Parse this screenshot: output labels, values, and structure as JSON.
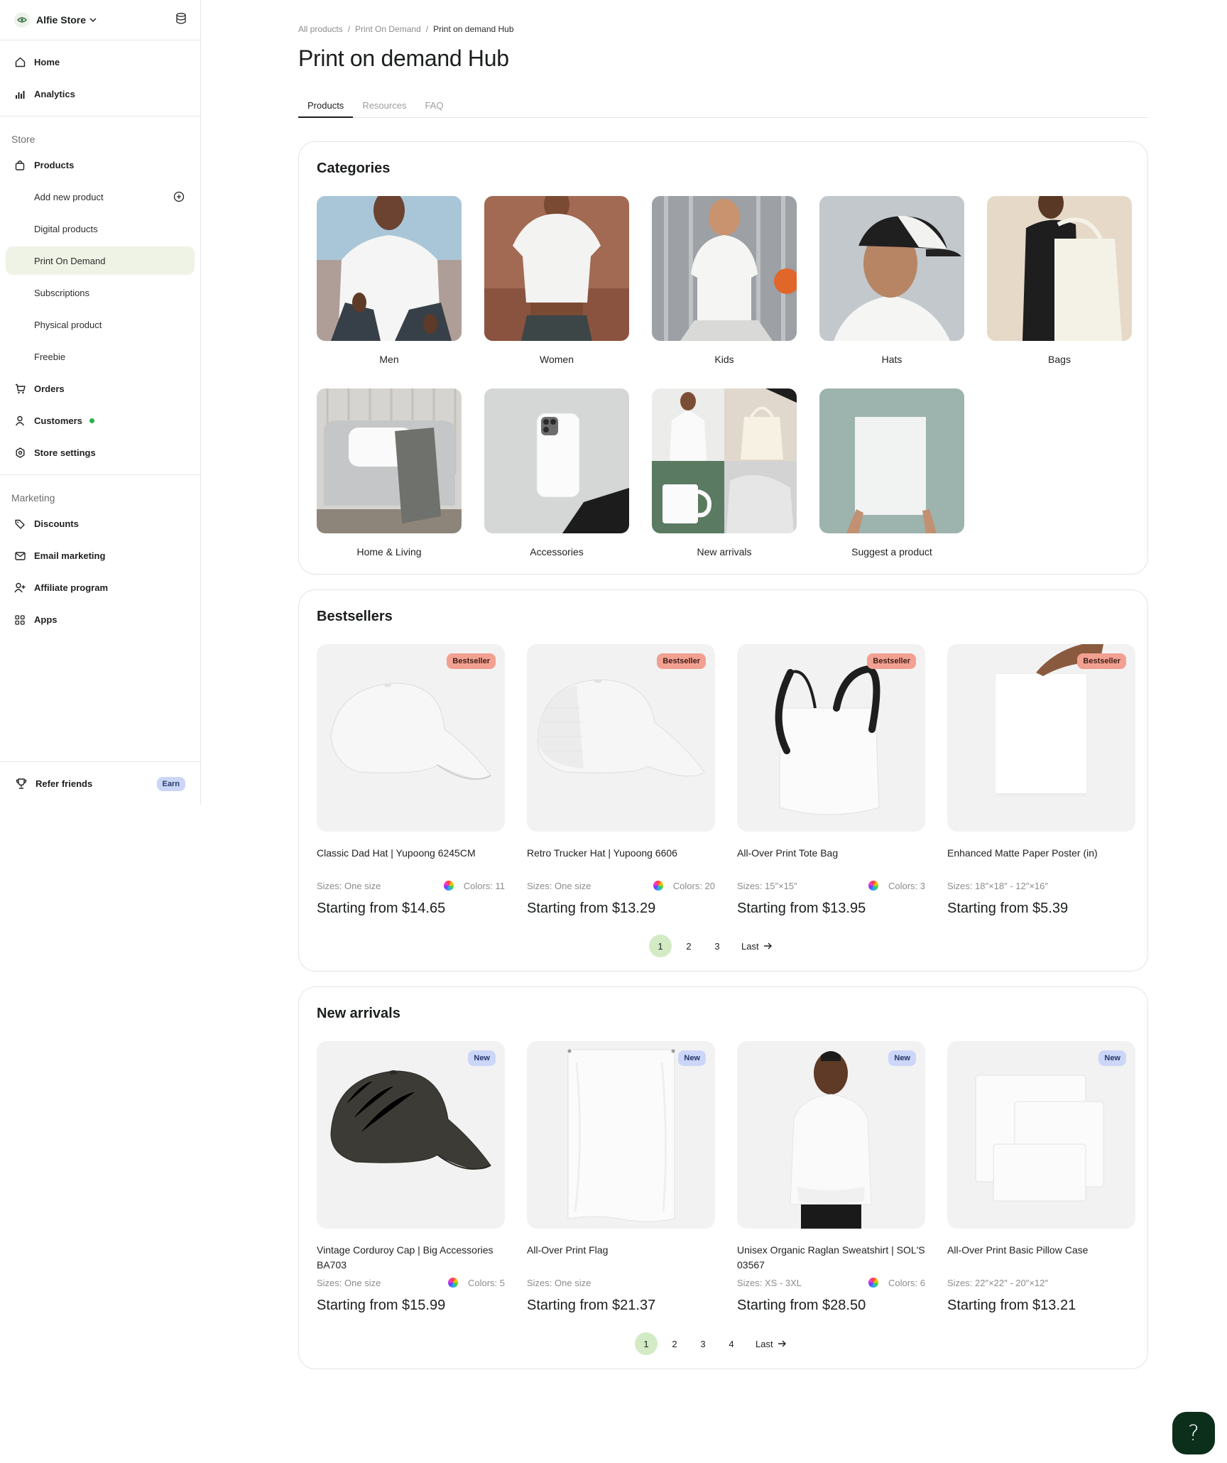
{
  "store": {
    "name": "Alfie Store"
  },
  "nav": {
    "home": "Home",
    "analytics": "Analytics",
    "store_section": "Store",
    "products": "Products",
    "add_new_product": "Add new product",
    "digital_products": "Digital products",
    "print_on_demand": "Print On Demand",
    "subscriptions": "Subscriptions",
    "physical_product": "Physical product",
    "freebie": "Freebie",
    "orders": "Orders",
    "customers": "Customers",
    "store_settings": "Store settings",
    "marketing_section": "Marketing",
    "discounts": "Discounts",
    "email_marketing": "Email marketing",
    "affiliate_program": "Affiliate program",
    "apps": "Apps",
    "refer_friends": "Refer friends",
    "earn_badge": "Earn"
  },
  "breadcrumb": [
    "All products",
    "Print On Demand",
    "Print on demand Hub"
  ],
  "breadcrumb_sep": "/",
  "page_title": "Print on demand Hub",
  "tabs": [
    "Products",
    "Resources",
    "FAQ"
  ],
  "categories": {
    "title": "Categories",
    "items": [
      "Men",
      "Women",
      "Kids",
      "Hats",
      "Bags",
      "Home & Living",
      "Accessories",
      "New arrivals",
      "Suggest a product"
    ]
  },
  "bestsellers": {
    "title": "Bestsellers",
    "badge": "Bestseller",
    "items": [
      {
        "name": "Classic Dad Hat | Yupoong 6245CM",
        "sizes": "Sizes: One size",
        "colors": "Colors: 11",
        "price": "Starting from $14.65"
      },
      {
        "name": "Retro Trucker Hat | Yupoong 6606",
        "sizes": "Sizes: One size",
        "colors": "Colors: 20",
        "price": "Starting from $13.29"
      },
      {
        "name": "All-Over Print Tote Bag",
        "sizes": "Sizes: 15″×15″",
        "colors": "Colors: 3",
        "price": "Starting from $13.95"
      },
      {
        "name": "Enhanced Matte Paper Poster (in)",
        "sizes": "Sizes: 18″×18″ - 12″×16″",
        "colors": "",
        "price": "Starting from $5.39"
      }
    ],
    "pages": [
      "1",
      "2",
      "3"
    ],
    "last": "Last"
  },
  "new_arrivals": {
    "title": "New arrivals",
    "badge": "New",
    "items": [
      {
        "name": "Vintage Corduroy Cap | Big Accessories BA703",
        "sizes": "Sizes: One size",
        "colors": "Colors: 5",
        "price": "Starting from $15.99"
      },
      {
        "name": "All-Over Print Flag",
        "sizes": "Sizes: One size",
        "colors": "",
        "price": "Starting from $21.37"
      },
      {
        "name": "Unisex Organic Raglan Sweatshirt | SOL'S 03567",
        "sizes": "Sizes: XS - 3XL",
        "colors": "Colors: 6",
        "price": "Starting from $28.50"
      },
      {
        "name": "All-Over Print Basic Pillow Case",
        "sizes": "Sizes: 22″×22″ - 20″×12″",
        "colors": "",
        "price": "Starting from $13.21"
      }
    ],
    "pages": [
      "1",
      "2",
      "3",
      "4"
    ],
    "last": "Last"
  },
  "help_label": "?",
  "colors": {
    "accent_green": "#d3ebc4",
    "active_nav": "#eef3e6",
    "bestseller_badge": "#f2a091",
    "new_badge": "#ccd6f8",
    "help_button": "#0c2f1c"
  }
}
